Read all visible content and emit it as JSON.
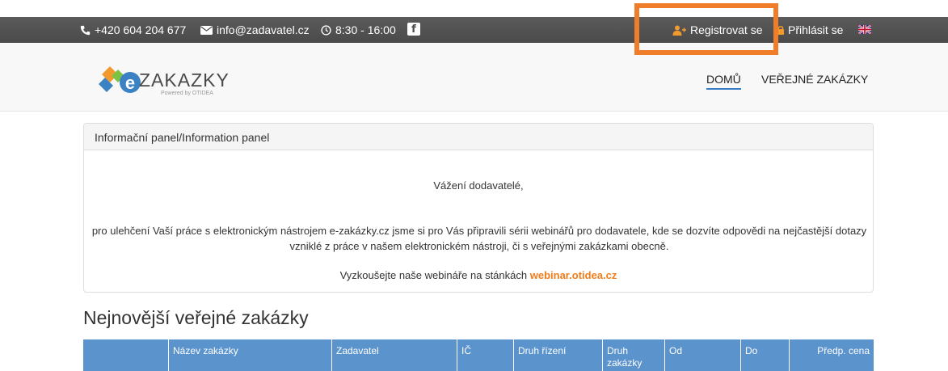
{
  "topbar": {
    "phone": "+420 604 204 677",
    "email": "info@zadavatel.cz",
    "hours": "8:30 - 16:00",
    "facebook_icon": "f",
    "register_label": "Registrovat se",
    "login_label": "Přihlásit se",
    "language_flag": "uk-flag-icon"
  },
  "header": {
    "logo_text": "ZAKAZKY",
    "logo_subtitle": "Powered by OTIDEA",
    "nav": [
      {
        "label": "DOMŮ"
      },
      {
        "label": "VEŘEJNÉ ZAKÁZKY"
      }
    ]
  },
  "info_panel": {
    "title": "Informační panel/Information panel",
    "greeting": "Vážení dodavatelé,",
    "text": "pro ulehčení Vaší práce s elektronickým nástrojem e-zakázky.cz jsme si pro Vás připravili sérii webinářů pro dodavatele, kde se dozvíte odpovědi na nejčastější dotazy vzniklé z práce v našem elektronickém nástroji, či s veřejnými zakázkami obecně.",
    "link_prefix": "Vyzkoušejte naše webináře na stánkách",
    "link_text": "webinar.otidea.cz"
  },
  "section_title": "Nejnovější veřejné zakázky",
  "table": {
    "columns": [
      "",
      "Název zakázky",
      "Zadavatel",
      "IČ",
      "Druh řízení",
      "Druh zakázky",
      "Od",
      "Do",
      "Předp. cena"
    ]
  },
  "colors": {
    "accent": "#f07d1c",
    "highlight": "#ef7d29",
    "table_header": "#5b93cc",
    "topbar": "#4f4f4f"
  }
}
